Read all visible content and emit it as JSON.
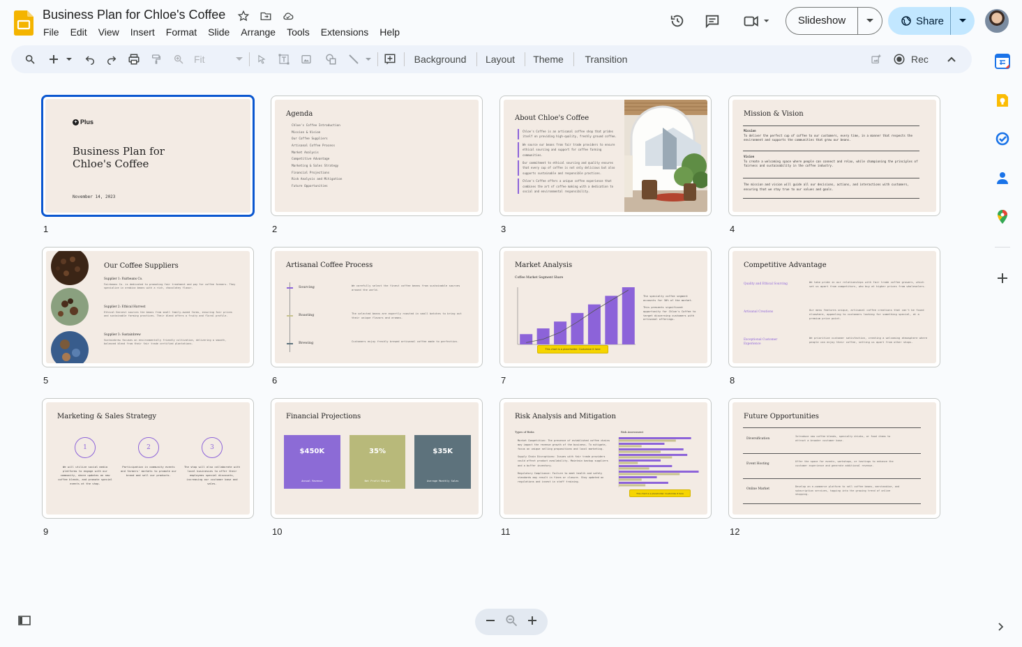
{
  "app": {
    "name": "Google Slides",
    "doc_title": "Business Plan for Chloe's Coffee"
  },
  "menu": [
    "File",
    "Edit",
    "View",
    "Insert",
    "Format",
    "Slide",
    "Arrange",
    "Tools",
    "Extensions",
    "Help"
  ],
  "header": {
    "slideshow_label": "Slideshow",
    "share_label": "Share"
  },
  "toolbar": {
    "zoom_value": "Fit",
    "background": "Background",
    "layout": "Layout",
    "theme": "Theme",
    "transition": "Transition",
    "rec": "Rec"
  },
  "slides": [
    {
      "num": "1",
      "logo": "Plus",
      "title_line1": "Business Plan for",
      "title_line2": "Chloe's Coffee",
      "date": "November 14, 2023"
    },
    {
      "num": "2",
      "title": "Agenda",
      "items": [
        "Chloe's Coffee Introduction",
        "Mission & Vision",
        "Our Coffee Suppliers",
        "Artisanal Coffee Process",
        "Market Analysis",
        "Competitive Advantage",
        "Marketing & Sales Strategy",
        "Financial Projections",
        "Risk Analysis and Mitigation",
        "Future Opportunities"
      ]
    },
    {
      "num": "3",
      "title": "About Chloe's Coffee",
      "bullets": [
        "Chloe's Coffee is an artisanal coffee shop that prides itself on providing high-quality, freshly ground coffee.",
        "We source our beans from fair trade providers to ensure ethical sourcing and support for coffee farming communities.",
        "Our commitment to ethical sourcing and quality ensures that every cup of coffee is not only delicious but also supports sustainable and responsible practices.",
        "Chloe's Coffee offers a unique coffee experience that combines the art of coffee making with a dedication to social and environmental responsibility."
      ]
    },
    {
      "num": "4",
      "title": "Mission & Vision",
      "mission_label": "Mission",
      "mission_text": "To deliver the perfect cup of coffee to our customers, every time, in a manner that respects the environment and supports the communities that grow our beans.",
      "vision_label": "Vision",
      "vision_text": "To create a welcoming space where people can connect and relax, while championing the principles of fairness and sustainability in the coffee industry.",
      "closing": "The mission and vision will guide all our decisions, actions, and interactions with customers, ensuring that we stay true to our values and goals."
    },
    {
      "num": "5",
      "title": "Our Coffee Suppliers",
      "suppliers": [
        {
          "name": "Supplier 1: Fairbeans Co.",
          "desc": "Fairbeans Co. is dedicated to promoting fair treatment and pay for coffee farmers. They specialize in arabica beans with a rich, chocolatey flavor."
        },
        {
          "name": "Supplier 2: Ethical Harvest",
          "desc": "Ethical Harvest sources the beans from small family-owned farms, ensuring fair prices and sustainable farming practices. Their blend offers a fruity and floral profile."
        },
        {
          "name": "Supplier 3: Sustainbrew",
          "desc": "Sustainbrew focuses on environmentally friendly cultivation, delivering a smooth, balanced blend from their fair trade certified plantations."
        }
      ]
    },
    {
      "num": "6",
      "title": "Artisanal Coffee Process",
      "steps": [
        {
          "name": "Sourcing",
          "desc": "We carefully select the finest coffee beans from sustainable sources around the world."
        },
        {
          "name": "Roasting",
          "desc": "The selected beans are expertly roasted in small batches to bring out their unique flavors and aromas."
        },
        {
          "name": "Brewing",
          "desc": "Customers enjoy freshly brewed artisanal coffee made to perfection."
        }
      ]
    },
    {
      "num": "7",
      "title": "Market Analysis",
      "chart_title": "Coffee Market Segment Share",
      "side_text_1": "The specialty coffee segment accounts for 30% of the market.",
      "side_text_2": "This presents significant opportunity for Chloe's Coffee to target discerning customers with artisanal offerings.",
      "placeholder": "This chart is a placeholder. Customize it here"
    },
    {
      "num": "8",
      "title": "Competitive Advantage",
      "rows": [
        {
          "name": "Quality and Ethical Sourcing",
          "desc": "We take pride in our relationships with fair trade coffee growers, which set us apart from competitors, who buy at higher prices from wholesalers."
        },
        {
          "name": "Artisanal Creations",
          "desc": "Our menu features unique, artisanal coffee creations that can't be found elsewhere, appealing to customers looking for something special, at a premium price point."
        },
        {
          "name": "Exceptional Customer Experience",
          "desc": "We prioritize customer satisfaction, creating a welcoming atmosphere where people can enjoy their coffee, setting us apart from other shops."
        }
      ]
    },
    {
      "num": "9",
      "title": "Marketing & Sales Strategy",
      "cols": [
        {
          "n": "1",
          "text": "We will utilize social media platforms to engage with our community, share updates on new coffee blends, and promote special events at the shop."
        },
        {
          "n": "2",
          "text": "Participation in community events and farmers' markets to promote our brand and sell our products."
        },
        {
          "n": "3",
          "text": "The shop will also collaborate with local businesses to offer their employees special discounts, increasing our customer base and sales."
        }
      ]
    },
    {
      "num": "10",
      "title": "Financial Projections",
      "boxes": [
        {
          "value": "$450K",
          "label": "Annual Revenue",
          "color": "#8c6bd6"
        },
        {
          "value": "35%",
          "label": "Net Profit Margin",
          "color": "#b8b97a"
        },
        {
          "value": "$35K",
          "label": "Average Monthly Sales",
          "color": "#5d727c"
        }
      ]
    },
    {
      "num": "11",
      "title": "Risk Analysis and Mitigation",
      "left_heading": "Types of Risks",
      "right_heading": "Risk Assessment",
      "bullets": [
        "Market Competition: The presence of established coffee chains may impact the revenue growth of the business. To mitigate, focus on unique selling propositions and local marketing.",
        "Supply Chain Disruptions: Issues with fair trade providers could affect product availability. Maintain backup suppliers and a buffer inventory.",
        "Regulatory Compliance: Failure to meet health and safety standards may result in fines or closure. Stay updated on regulations and invest in staff training."
      ],
      "placeholder": "This chart is a placeholder. Customize it here"
    },
    {
      "num": "12",
      "title": "Future Opportunities",
      "rows": [
        {
          "name": "Diversification",
          "desc": "Introduce new coffee blends, specialty drinks, or food items to attract a broader customer base."
        },
        {
          "name": "Event Hosting",
          "desc": "Offer the space for events, workshops, or tastings to enhance the customer experience and generate additional revenue."
        },
        {
          "name": "Online Market",
          "desc": "Develop an e-commerce platform to sell coffee beans, merchandise, and subscription services, tapping into the growing trend of online shopping."
        }
      ]
    }
  ],
  "charts": {
    "market": {
      "type": "bar",
      "values": [
        18,
        28,
        40,
        55,
        70,
        85,
        100
      ],
      "line_values": [
        8,
        14,
        26,
        44,
        64,
        82,
        100
      ]
    },
    "risk": {
      "type": "bar",
      "series_a": [
        95,
        60,
        85,
        90,
        55,
        70,
        105,
        50,
        65
      ],
      "series_b": [
        75,
        30,
        55,
        70,
        25,
        40,
        80,
        30,
        35
      ]
    }
  },
  "colors": {
    "accent": "#0b57d0",
    "slide_bg": "#f3ebe4",
    "chart_purple": "#8c63d9",
    "chart_olive": "#c7c28e",
    "placeholder": "#f6d500"
  }
}
